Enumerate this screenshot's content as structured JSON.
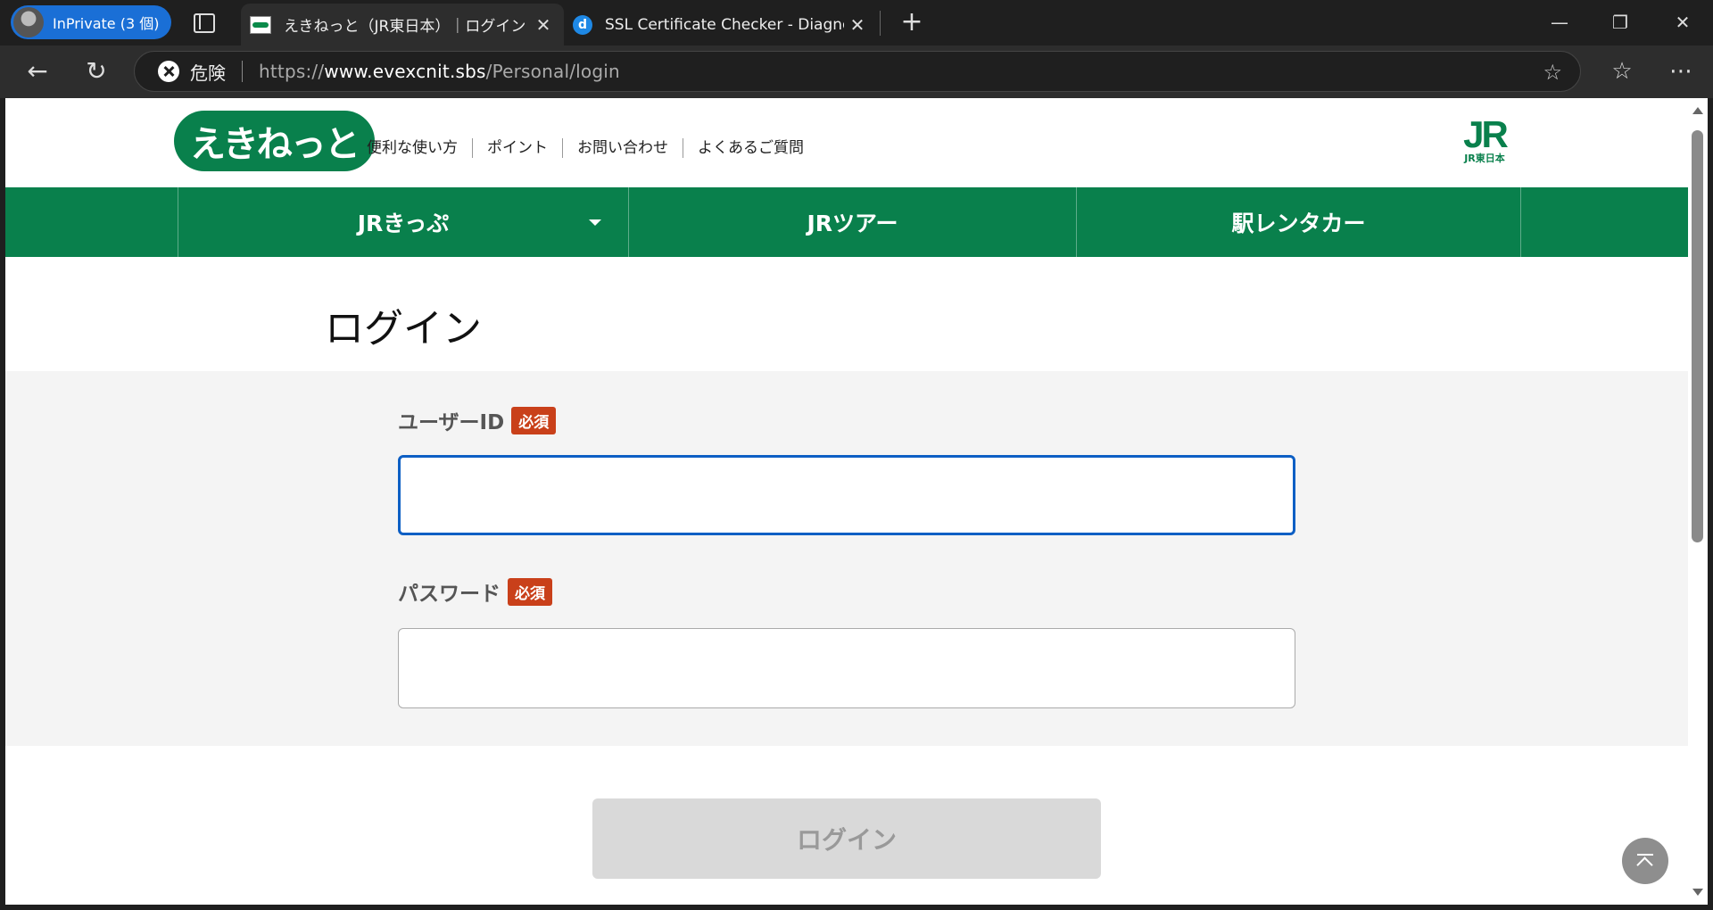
{
  "browser": {
    "profile_label": "InPrivate (3 個)",
    "tabs": [
      {
        "title": "えきねっと（JR東日本）｜ログイン",
        "active": true
      },
      {
        "title": "SSL Certificate Checker - Diagnostic",
        "active": false
      }
    ],
    "security_label": "危険",
    "url_prefix": "https://",
    "url_domain": "www.evexcnit.sbs",
    "url_path": "/Personal/login"
  },
  "header": {
    "logo_text": "えきねっと",
    "nav": [
      "便利な使い方",
      "ポイント",
      "お問い合わせ",
      "よくあるご質問"
    ],
    "jr_logo": "JR",
    "jr_logo_sub": "JR東日本"
  },
  "main_nav": [
    "JRきっぷ",
    "JRツアー",
    "駅レンタカー"
  ],
  "page": {
    "title": "ログイン",
    "user_id_label": "ユーザーID",
    "password_label": "パスワード",
    "required_badge": "必須",
    "user_id_value": "",
    "password_value": "",
    "login_button": "ログイン"
  },
  "colors": {
    "brand_green": "#09804c",
    "required_red": "#c9401a",
    "focus_blue": "#0d5fc4"
  }
}
